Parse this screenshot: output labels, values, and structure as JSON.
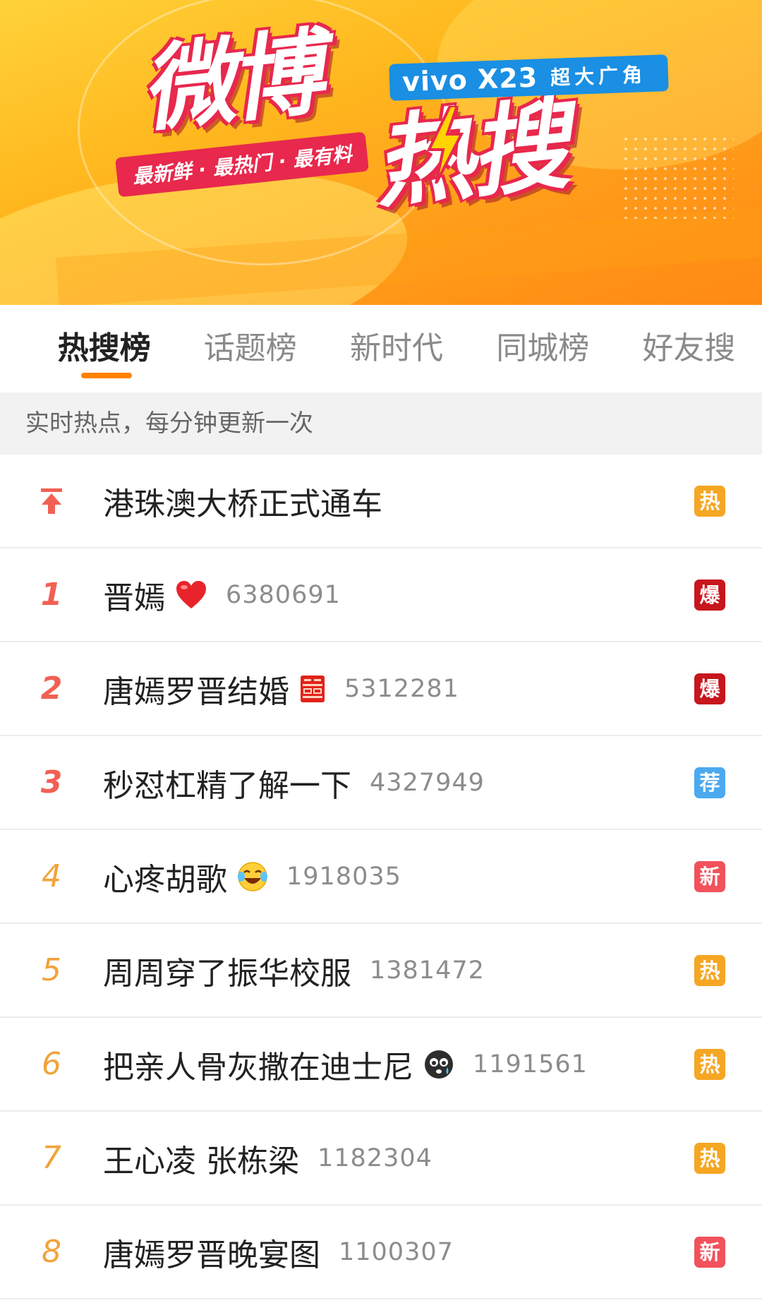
{
  "banner": {
    "title_main": "微博",
    "title_sub": "热搜",
    "slogan": "最新鲜 · 最热门 · 最有料",
    "sponsor_brand": "vivo X23",
    "sponsor_tag": "超大广角"
  },
  "tabs": [
    {
      "label": "热搜榜",
      "active": true
    },
    {
      "label": "话题榜",
      "active": false
    },
    {
      "label": "新时代",
      "active": false
    },
    {
      "label": "同城榜",
      "active": false
    },
    {
      "label": "好友搜",
      "active": false
    }
  ],
  "info_text": "实时热点，每分钟更新一次",
  "colors": {
    "accent": "#ff8200",
    "rank_top": "#f26054",
    "rank_other": "#f2a33a",
    "badge_hot": "#f5a623",
    "badge_boom": "#c7161d",
    "badge_rec": "#4ca9f0",
    "badge_new": "#f2525c"
  },
  "pinned": {
    "title": "港珠澳大桥正式通车",
    "badge": "热",
    "badge_type": "hot"
  },
  "items": [
    {
      "rank": "1",
      "title": "晋嫣",
      "emoji": "heart-icon",
      "count": "6380691",
      "badge": "爆",
      "badge_type": "boom"
    },
    {
      "rank": "2",
      "title": "唐嫣罗晋结婚",
      "emoji": "double-happiness-icon",
      "count": "5312281",
      "badge": "爆",
      "badge_type": "boom"
    },
    {
      "rank": "3",
      "title": "秒怼杠精了解一下",
      "emoji": "",
      "count": "4327949",
      "badge": "荐",
      "badge_type": "rec"
    },
    {
      "rank": "4",
      "title": "心疼胡歌",
      "emoji": "crying-laugh-icon",
      "count": "1918035",
      "badge": "新",
      "badge_type": "new"
    },
    {
      "rank": "5",
      "title": "周周穿了振华校服",
      "emoji": "",
      "count": "1381472",
      "badge": "热",
      "badge_type": "hot"
    },
    {
      "rank": "6",
      "title": "把亲人骨灰撒在迪士尼",
      "emoji": "crying-face-icon",
      "count": "1191561",
      "badge": "热",
      "badge_type": "hot"
    },
    {
      "rank": "7",
      "title": "王心凌 张栋梁",
      "emoji": "",
      "count": "1182304",
      "badge": "热",
      "badge_type": "hot"
    },
    {
      "rank": "8",
      "title": "唐嫣罗晋晚宴图",
      "emoji": "",
      "count": "1100307",
      "badge": "新",
      "badge_type": "new"
    }
  ]
}
